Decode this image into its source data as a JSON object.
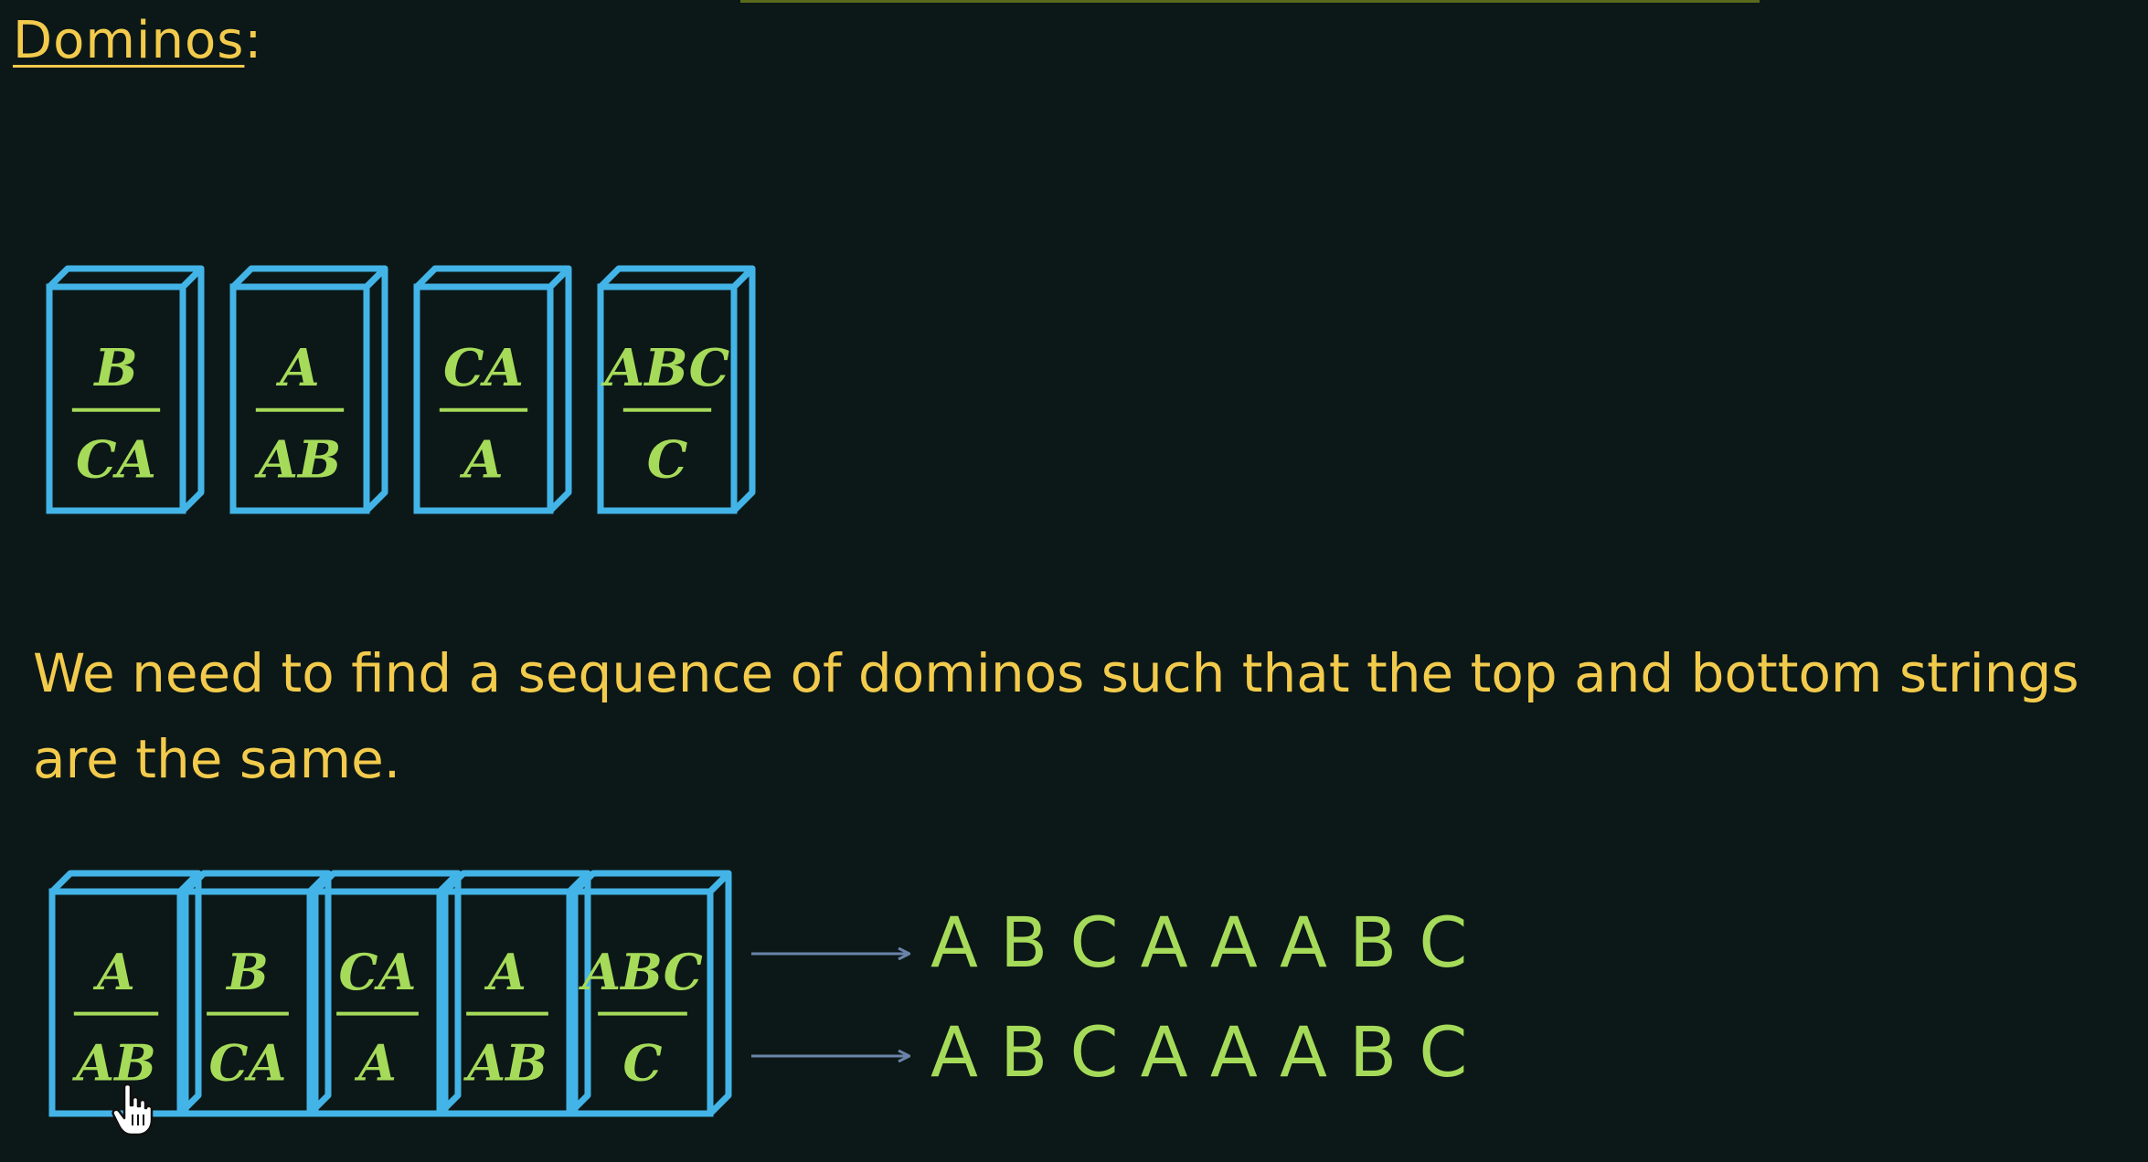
{
  "title": "Dominos",
  "title_colon": ":",
  "instruction": "We need to find a sequence of dominos such that the top and bottom strings are the same.",
  "colors": {
    "background": "#0c1817",
    "domino_outline": "#43b4e7",
    "domino_text": "#a6db5a",
    "heading_text": "#f3cb4c",
    "arrow": "#6a83a8"
  },
  "dominos": [
    {
      "top": "B",
      "bottom": "CA"
    },
    {
      "top": "A",
      "bottom": "AB"
    },
    {
      "top": "CA",
      "bottom": "A"
    },
    {
      "top": "ABC",
      "bottom": "C"
    }
  ],
  "sequence": [
    {
      "top": "A",
      "bottom": "AB"
    },
    {
      "top": "B",
      "bottom": "CA"
    },
    {
      "top": "CA",
      "bottom": "A"
    },
    {
      "top": "A",
      "bottom": "AB"
    },
    {
      "top": "ABC",
      "bottom": "C"
    }
  ],
  "result_top": "A B C A A A B C",
  "result_bottom": "A B C A A A B C",
  "cursor_icon": "hand-pointer-icon"
}
